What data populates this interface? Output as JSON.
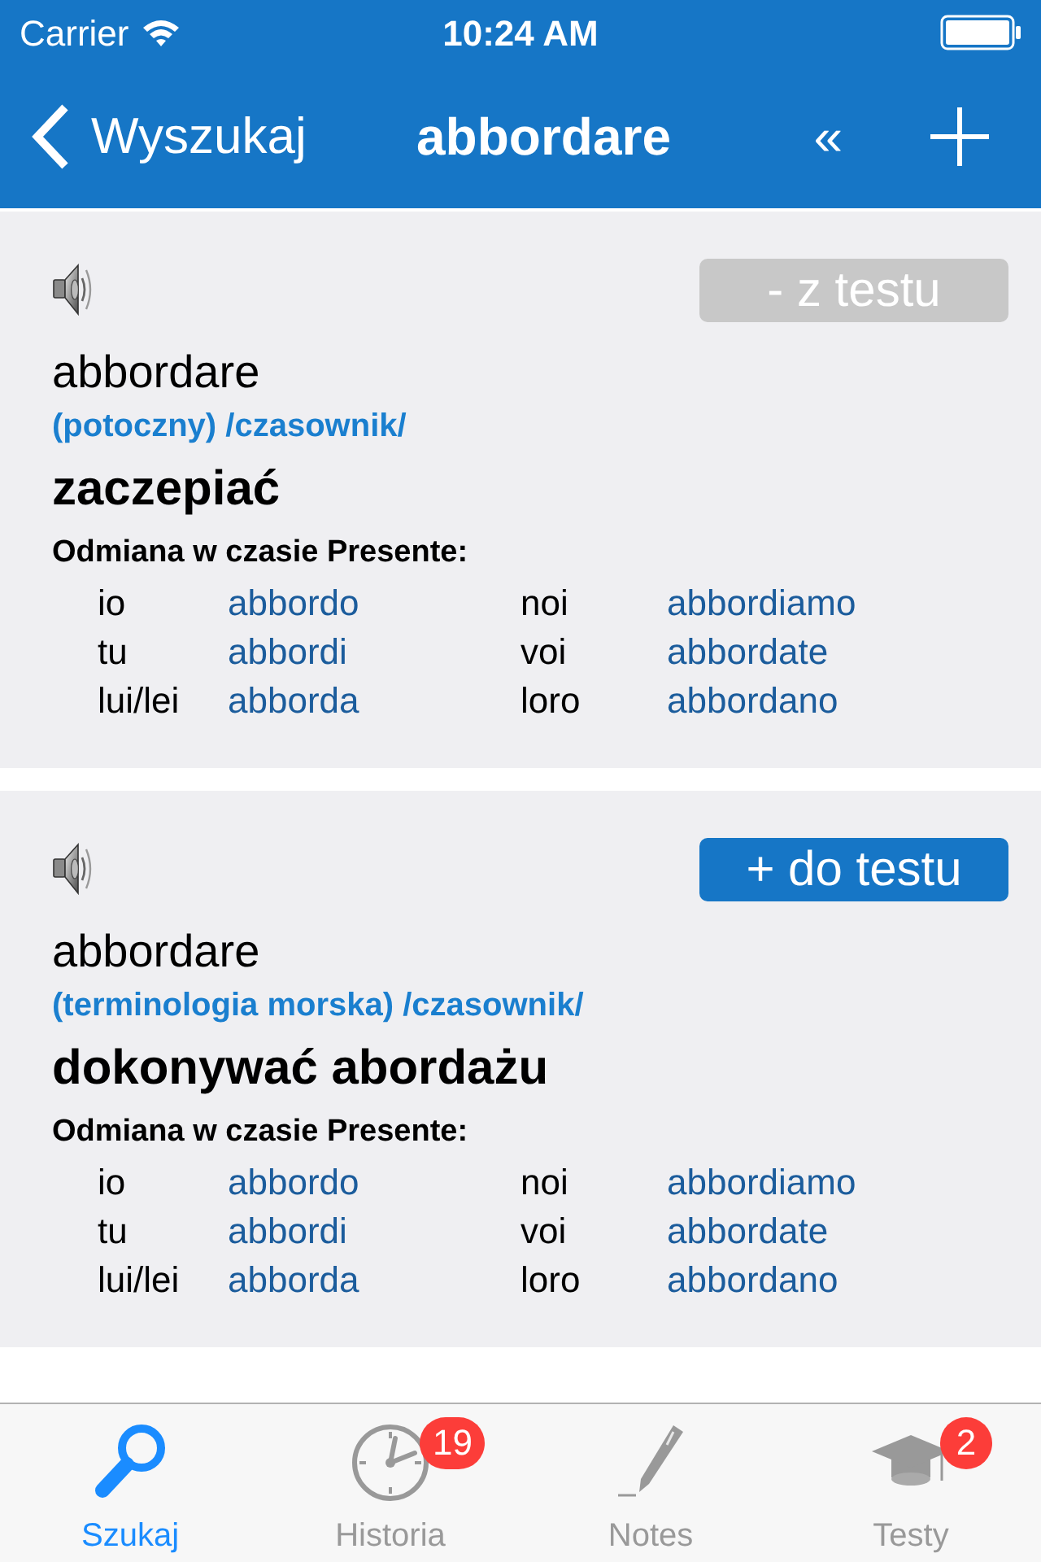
{
  "status_bar": {
    "carrier": "Carrier",
    "time": "10:24 AM"
  },
  "nav_bar": {
    "back_label": "Wyszukaj",
    "title": "abbordare",
    "collapse_label": "«"
  },
  "entries": [
    {
      "test_button": {
        "label": "- z testu",
        "kind": "remove"
      },
      "word": "abbordare",
      "category": "(potoczny) /czasownik/",
      "translation": "zaczepiać",
      "conjugation_title": "Odmiana w czasie Presente:",
      "conjugation": [
        {
          "pronoun": "io",
          "form": "abbordo",
          "pronoun_2": "noi",
          "form_2": "abbordiamo"
        },
        {
          "pronoun": "tu",
          "form": "abbordi",
          "pronoun_2": "voi",
          "form_2": "abbordate"
        },
        {
          "pronoun": "lui/lei",
          "form": "abborda",
          "pronoun_2": "loro",
          "form_2": "abbordano"
        }
      ]
    },
    {
      "test_button": {
        "label": "+ do testu",
        "kind": "add"
      },
      "word": "abbordare",
      "category": "(terminologia morska) /czasownik/",
      "translation": "dokonywać abordażu",
      "conjugation_title": "Odmiana w czasie Presente:",
      "conjugation": [
        {
          "pronoun": "io",
          "form": "abbordo",
          "pronoun_2": "noi",
          "form_2": "abbordiamo"
        },
        {
          "pronoun": "tu",
          "form": "abbordi",
          "pronoun_2": "voi",
          "form_2": "abbordate"
        },
        {
          "pronoun": "lui/lei",
          "form": "abborda",
          "pronoun_2": "loro",
          "form_2": "abbordano"
        }
      ]
    }
  ],
  "tab_bar": [
    {
      "label": "Szukaj",
      "selected": true
    },
    {
      "label": "Historia",
      "selected": false,
      "badge": "19"
    },
    {
      "label": "Notes",
      "selected": false
    },
    {
      "label": "Testy",
      "selected": false,
      "badge": "2"
    }
  ]
}
